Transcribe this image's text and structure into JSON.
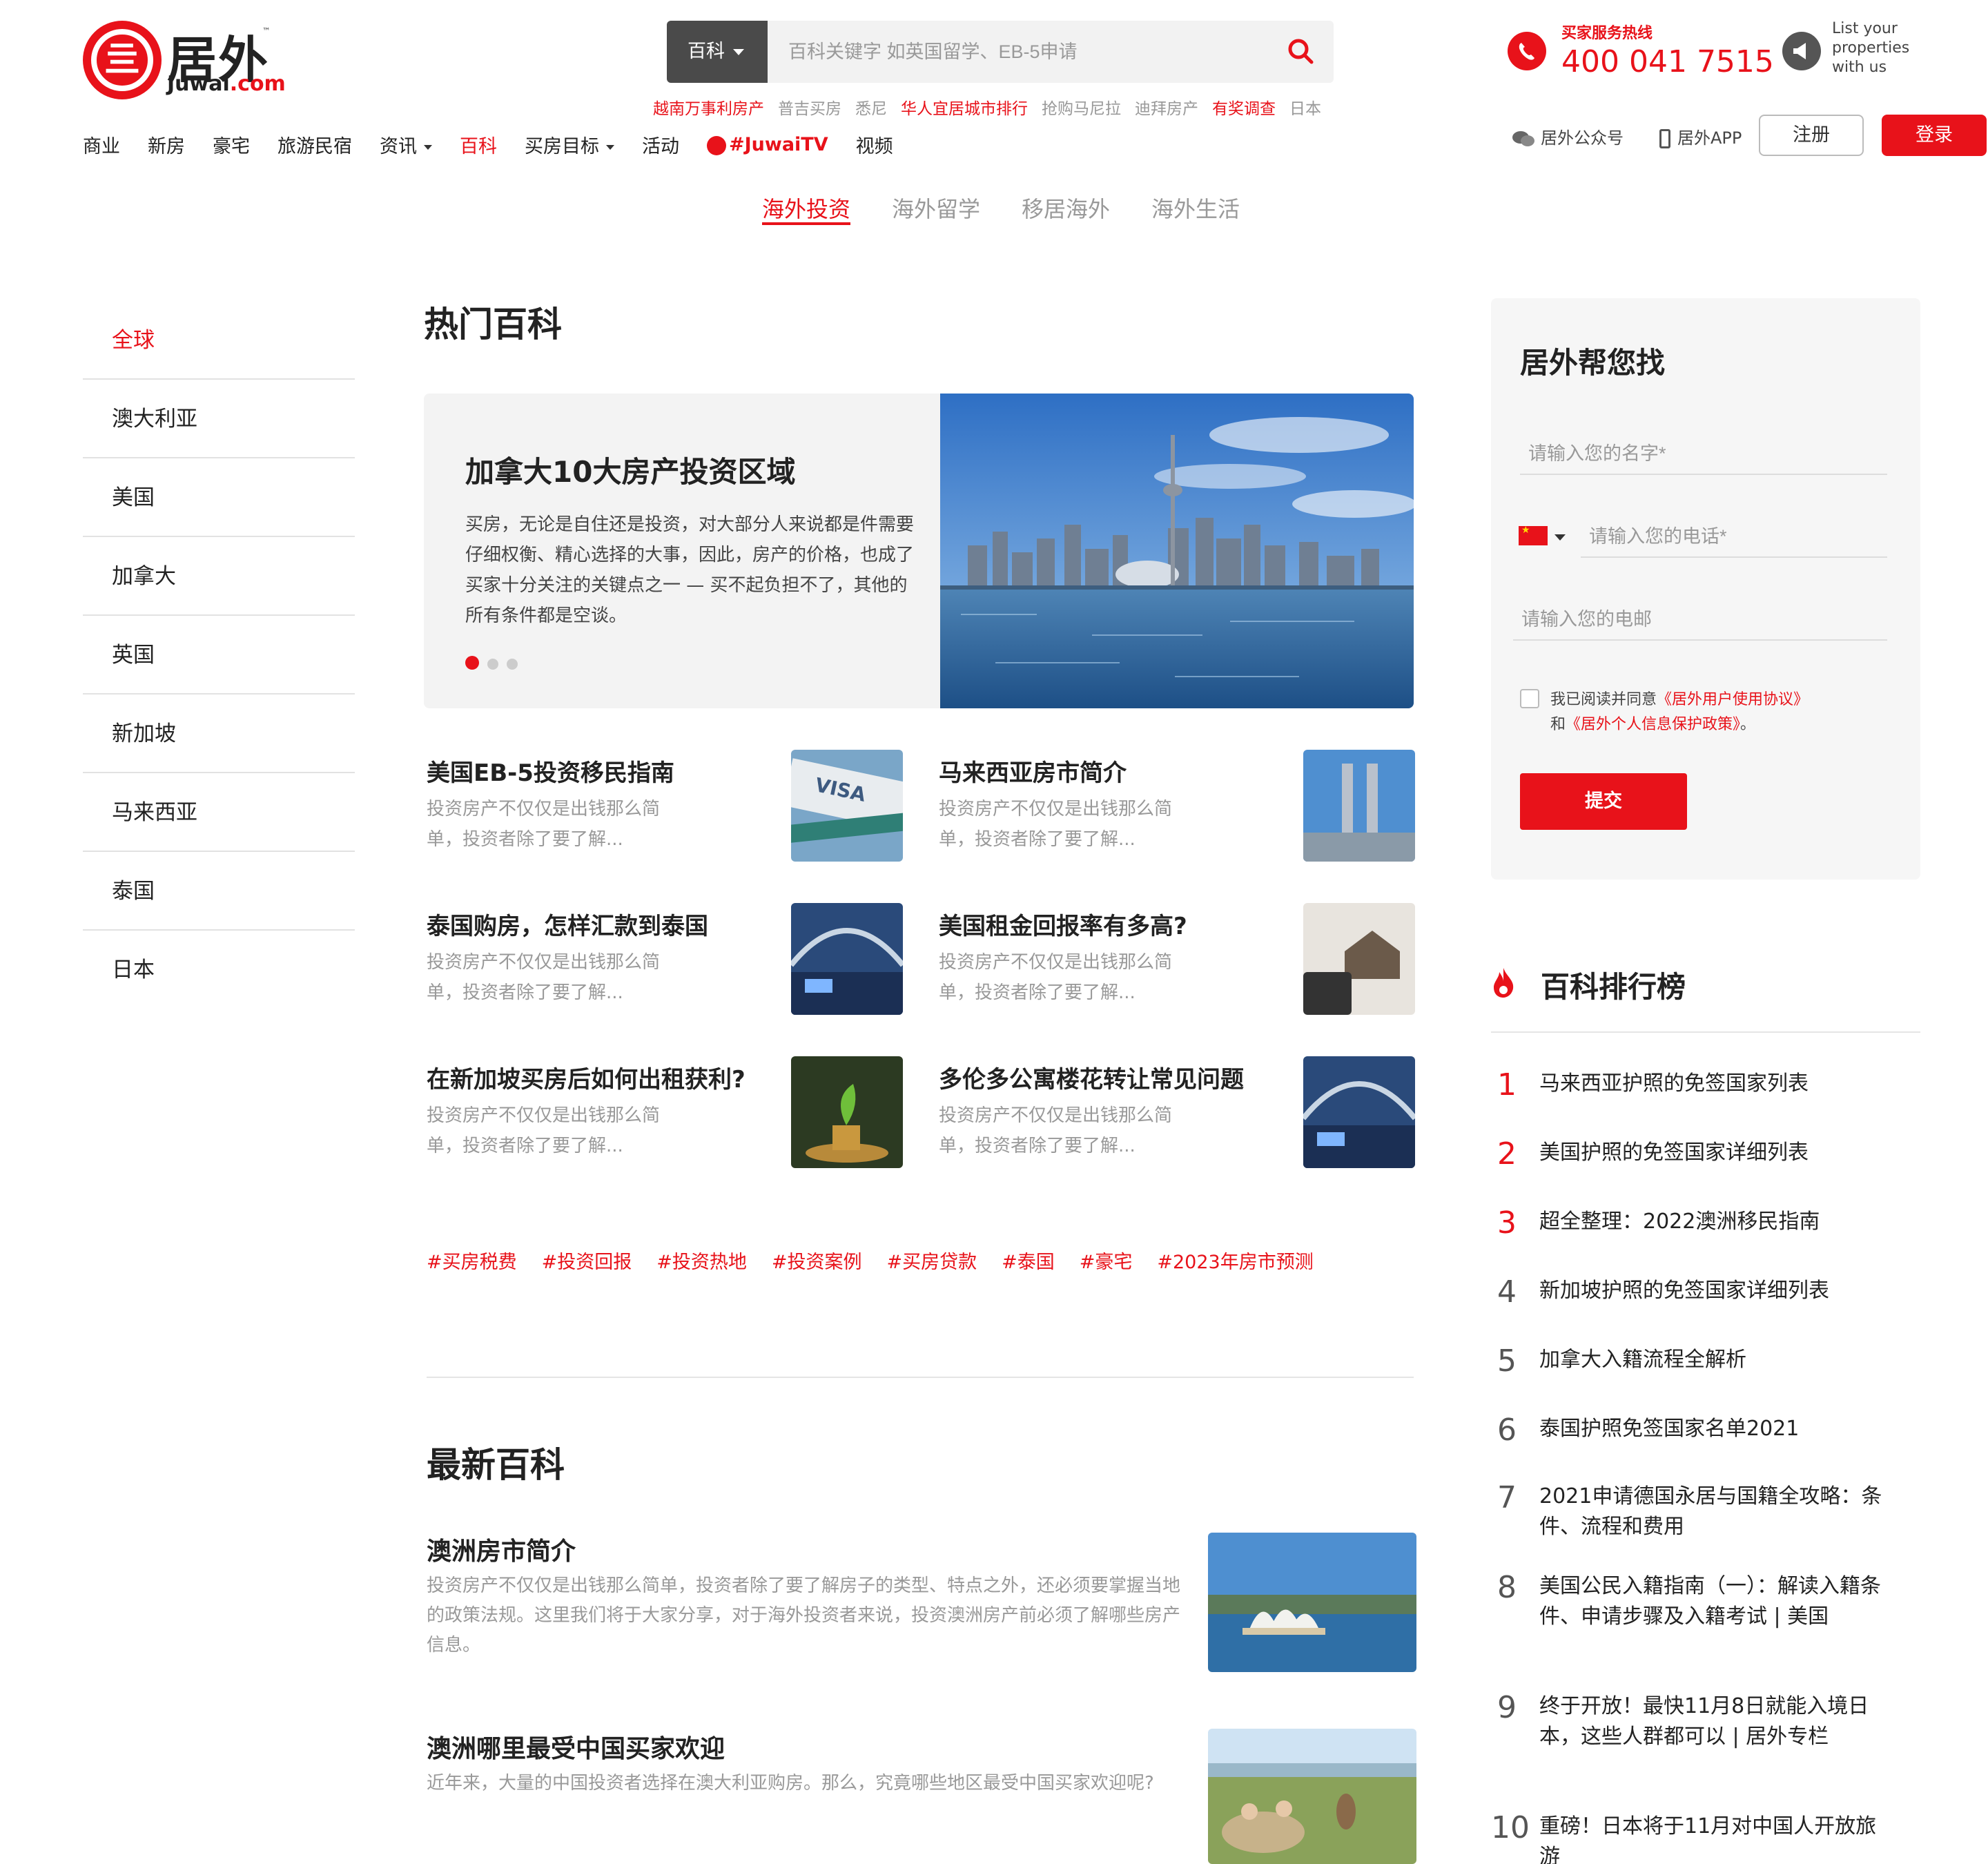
{
  "header": {
    "logo_cn": "居外",
    "logo_en_main": "Juwai",
    "logo_en_suffix": ".com",
    "logo_tm": "™",
    "search_category": "百科",
    "search_placeholder": "百科关键字 如英国留学、EB-5申请",
    "hotlinks": [
      {
        "label": "越南万事利房产",
        "style": "red"
      },
      {
        "label": "普吉买房",
        "style": "gray"
      },
      {
        "label": "悉尼",
        "style": "gray"
      },
      {
        "label": "华人宜居城市排行",
        "style": "red"
      },
      {
        "label": "抢购马尼拉",
        "style": "gray"
      },
      {
        "label": "迪拜房产",
        "style": "gray"
      },
      {
        "label": "有奖调查",
        "style": "red"
      },
      {
        "label": "日本",
        "style": "gray"
      }
    ],
    "hotline_label": "买家服务热线",
    "hotline_number": "400 041 7515",
    "list_properties": "List your properties with us",
    "nav": [
      {
        "label": "商业"
      },
      {
        "label": "新房"
      },
      {
        "label": "豪宅"
      },
      {
        "label": "旅游民宿"
      },
      {
        "label": "资讯",
        "dropdown": true
      },
      {
        "label": "百科",
        "active": true
      },
      {
        "label": "买房目标",
        "dropdown": true
      },
      {
        "label": "活动"
      },
      {
        "label": "#JuwaiTV",
        "tv": true
      },
      {
        "label": "视频"
      }
    ],
    "wechat_label": "居外公众号",
    "app_label": "居外APP",
    "register_label": "注册",
    "login_label": "登录"
  },
  "subtabs": [
    "海外投资",
    "海外留学",
    "移居海外",
    "海外生活"
  ],
  "sidebar": [
    "全球",
    "澳大利亚",
    "美国",
    "加拿大",
    "英国",
    "新加坡",
    "马来西亚",
    "泰国",
    "日本"
  ],
  "hot": {
    "heading": "热门百科",
    "feature": {
      "title": "加拿大10大房产投资区域",
      "desc": "买房，无论是自住还是投资，对大部分人来说都是件需要仔细权衡、精心选择的大事，因此，房产的价格，也成了买家十分关注的关键点之一 — 买不起负担不了，其他的所有条件都是空谈。"
    },
    "cards": [
      {
        "title": "美国EB-5投资移民指南",
        "desc": "投资房产不仅仅是出钱那么简单，投资者除了要了解..."
      },
      {
        "title": "马来西亚房市简介",
        "desc": "投资房产不仅仅是出钱那么简单，投资者除了要了解..."
      },
      {
        "title": "泰国购房，怎样汇款到泰国",
        "desc": "投资房产不仅仅是出钱那么简单，投资者除了要了解..."
      },
      {
        "title": "美国租金回报率有多高?",
        "desc": "投资房产不仅仅是出钱那么简单，投资者除了要了解..."
      },
      {
        "title": "在新加坡买房后如何出租获利?",
        "desc": "投资房产不仅仅是出钱那么简单，投资者除了要了解..."
      },
      {
        "title": "多伦多公寓楼花转让常见问题",
        "desc": "投资房产不仅仅是出钱那么简单，投资者除了要了解..."
      }
    ],
    "tags": [
      "#买房税费",
      "#投资回报",
      "#投资热地",
      "#投资案例",
      "#买房贷款",
      "#泰国",
      "#豪宅",
      "#2023年房市预测"
    ]
  },
  "latest": {
    "heading": "最新百科",
    "items": [
      {
        "title": "澳洲房市简介",
        "desc": "投资房产不仅仅是出钱那么简单，投资者除了要了解房子的类型、特点之外，还必须要掌握当地的政策法规。这里我们将于大家分享，对于海外投资者来说，投资澳洲房产前必须了解哪些房产信息。"
      },
      {
        "title": "澳洲哪里最受中国买家欢迎",
        "desc": "近年来，大量的中国投资者选择在澳大利亚购房。那么，究竟哪些地区最受中国买家欢迎呢?"
      }
    ]
  },
  "form": {
    "title": "居外帮您找",
    "name_placeholder": "请输入您的名字*",
    "phone_placeholder": "请输入您的电话*",
    "email_placeholder": "请输入您的电邮",
    "agree_prefix": "我已阅读并同意",
    "agree_link1": "《居外用户使用协议》",
    "agree_and": "和",
    "agree_link2": "《居外个人信息保护政策》",
    "agree_end": "。",
    "submit_label": "提交"
  },
  "ranking": {
    "heading": "百科排行榜",
    "items": [
      {
        "num": "1",
        "text": "马来西亚护照的免签国家列表"
      },
      {
        "num": "2",
        "text": "美国护照的免签国家详细列表"
      },
      {
        "num": "3",
        "text": "超全整理：2022澳洲移民指南"
      },
      {
        "num": "4",
        "text": "新加坡护照的免签国家详细列表"
      },
      {
        "num": "5",
        "text": "加拿大入籍流程全解析"
      },
      {
        "num": "6",
        "text": "泰国护照免签国家名单2021"
      },
      {
        "num": "7",
        "text": "2021申请德国永居与国籍全攻略：条件、流程和费用"
      },
      {
        "num": "8",
        "text": "美国公民入籍指南（一）：解读入籍条件、申请步骤及入籍考试 | 美国"
      },
      {
        "num": "9",
        "text": "终于开放！最快11月8日就能入境日本，这些人群都可以 | 居外专栏"
      },
      {
        "num": "10",
        "text": "重磅！日本将于11月对中国人开放旅游"
      }
    ]
  },
  "colors": {
    "accent": "#e8121a"
  }
}
